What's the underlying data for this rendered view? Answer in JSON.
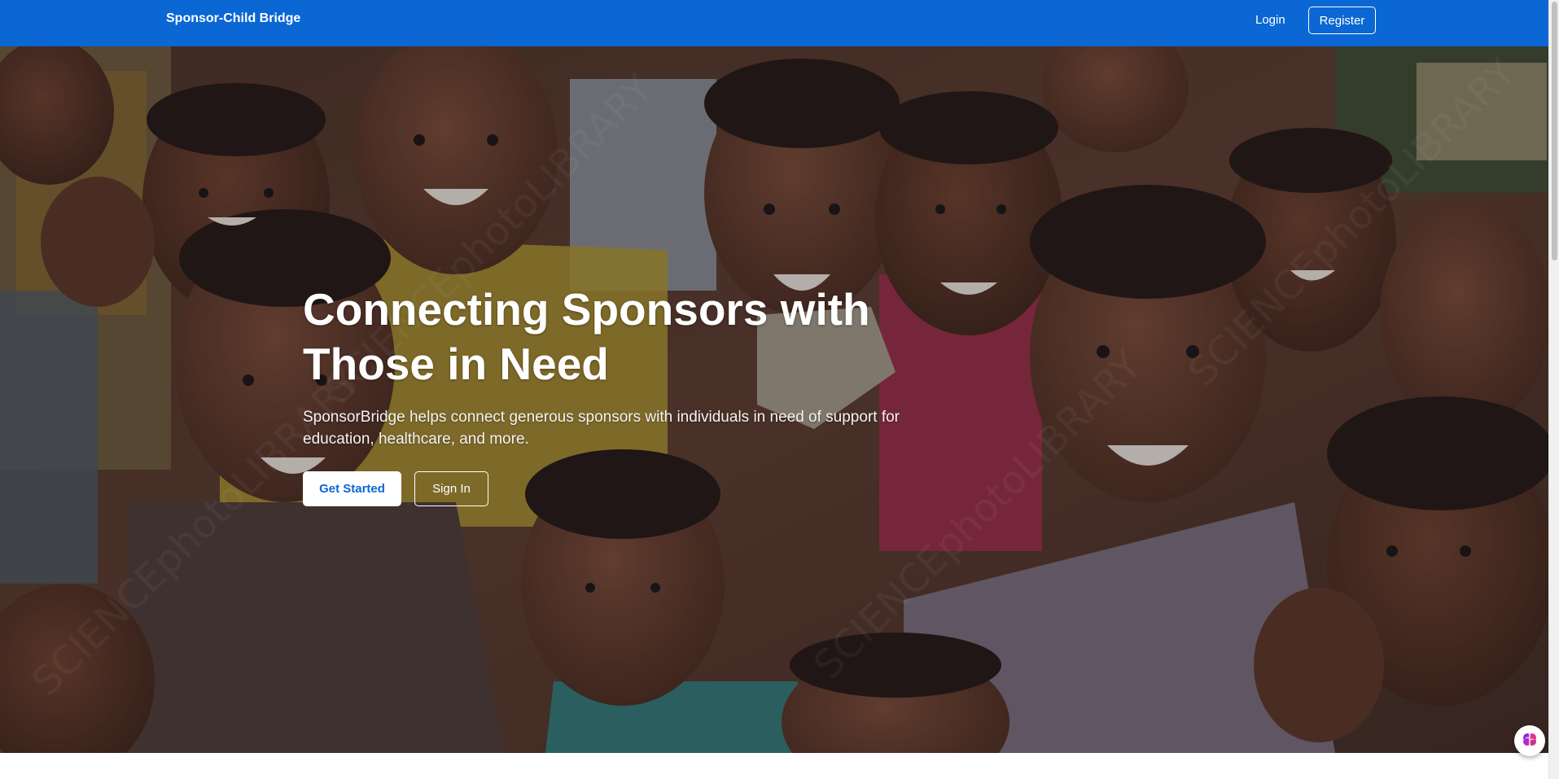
{
  "navbar": {
    "brand": "Sponsor-Child Bridge",
    "login_label": "Login",
    "register_label": "Register"
  },
  "hero": {
    "title": "Connecting Sponsors with Those in Need",
    "subtitle": "SponsorBridge helps connect generous sponsors with individuals in need of support for education, healthcare, and more.",
    "primary_button": "Get Started",
    "secondary_button": "Sign In",
    "image_watermark": "SCIENCEphotoLIBRARY"
  },
  "widget": {
    "icon": "brain-icon"
  },
  "colors": {
    "navbar_bg": "#0a67d4",
    "primary_button_text": "#0a67d4",
    "hero_text": "#ffffff"
  }
}
